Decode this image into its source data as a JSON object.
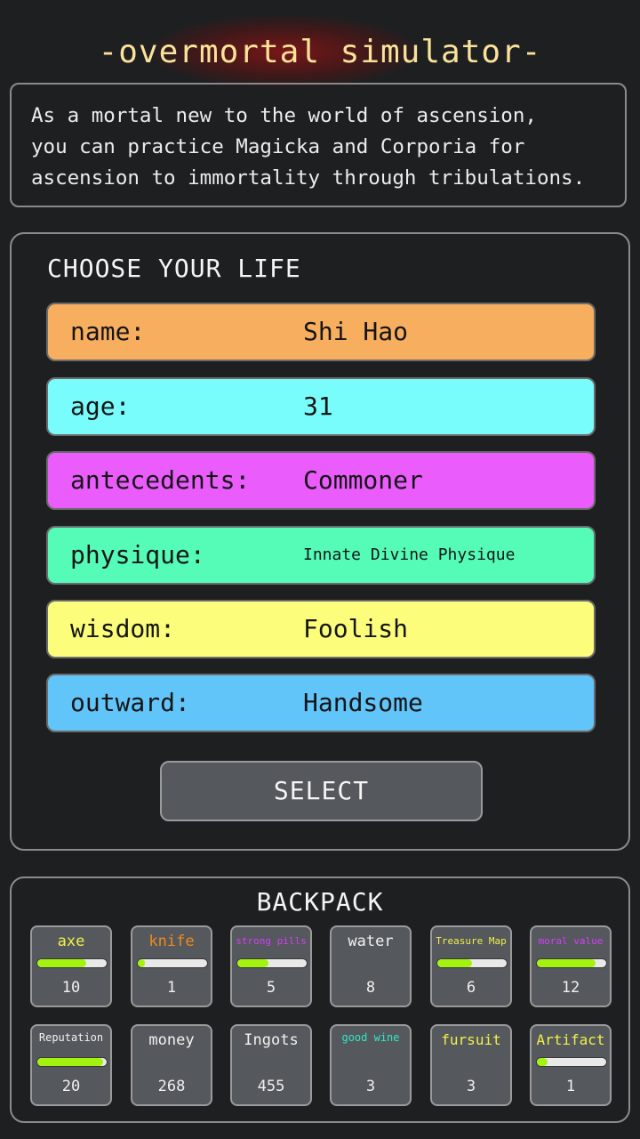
{
  "game": {
    "title": "-overmortal simulator-",
    "intro": "As a mortal new to the world of ascension,\nyou can practice Magicka and Corporia for\nascension to immortality through tribulations."
  },
  "choose_life": {
    "heading": "CHOOSE YOUR LIFE",
    "attributes": [
      {
        "label": "name:",
        "value": "Shi Hao",
        "color": "#f7ae5f"
      },
      {
        "label": "age:",
        "value": "31",
        "color": "#78fdfc"
      },
      {
        "label": "antecedents:",
        "value": "Commoner",
        "color": "#ea5cfc"
      },
      {
        "label": "physique:",
        "value": "Innate Divine Physique",
        "color": "#55fcb8"
      },
      {
        "label": "wisdom:",
        "value": "Foolish",
        "color": "#fbfd7b"
      },
      {
        "label": "outward:",
        "value": "Handsome",
        "color": "#62c5fa"
      }
    ],
    "select_label": "SELECT"
  },
  "backpack": {
    "title": "BACKPACK",
    "items": [
      {
        "name": "axe",
        "count": "10",
        "color": "#f1f04a",
        "progress": 0.7,
        "icon": "axe-icon"
      },
      {
        "name": "knife",
        "count": "1",
        "color": "#f08a1c",
        "progress": 0.1,
        "icon": "knife-icon"
      },
      {
        "name": "strong pills",
        "count": "5",
        "color": "#d63cfc",
        "progress": 0.45,
        "icon": "pills-icon"
      },
      {
        "name": "water",
        "count": "8",
        "color": "#f2f2f2",
        "progress": null,
        "icon": "water-icon"
      },
      {
        "name": "Treasure Map",
        "count": "6",
        "color": "#f1f04a",
        "progress": 0.5,
        "icon": "map-icon"
      },
      {
        "name": "moral value",
        "count": "12",
        "color": "#d63cfc",
        "progress": 0.85,
        "icon": "moral-icon"
      },
      {
        "name": "Reputation",
        "count": "20",
        "color": "#f2f2f2",
        "progress": 0.95,
        "icon": "reputation-icon"
      },
      {
        "name": "money",
        "count": "268",
        "color": "#f2f2f2",
        "progress": null,
        "icon": "money-icon"
      },
      {
        "name": "Ingots",
        "count": "455",
        "color": "#f2f2f2",
        "progress": null,
        "icon": "ingots-icon"
      },
      {
        "name": "good wine",
        "count": "3",
        "color": "#2fe8c8",
        "progress": null,
        "icon": "wine-icon"
      },
      {
        "name": "fursuit",
        "count": "3",
        "color": "#f1f04a",
        "progress": null,
        "icon": "fursuit-icon"
      },
      {
        "name": "Artifact",
        "count": "1",
        "color": "#f1f04a",
        "progress": 0.15,
        "icon": "artifact-icon"
      }
    ]
  }
}
